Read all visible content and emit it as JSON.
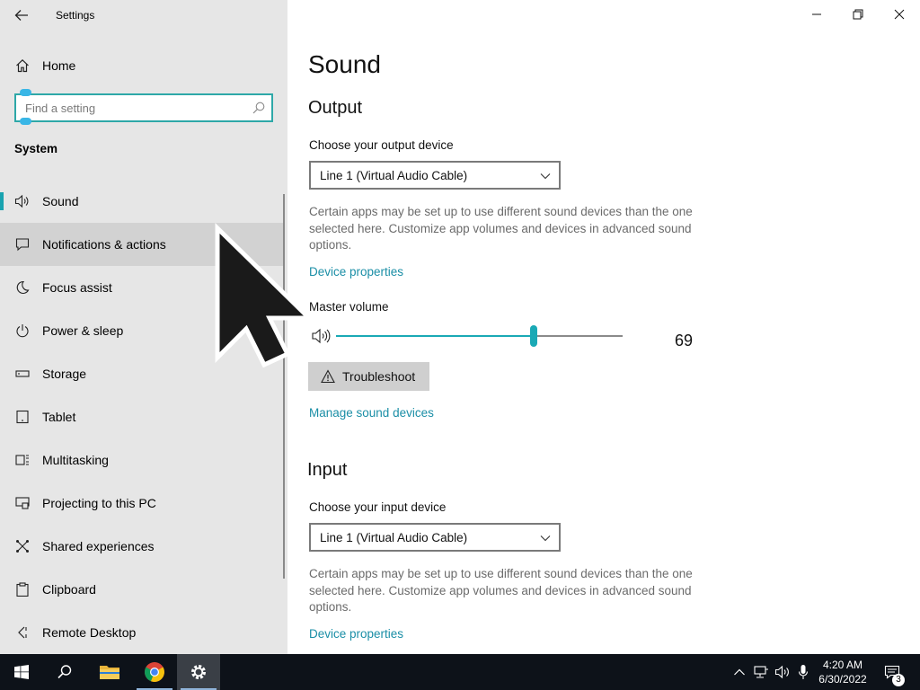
{
  "window": {
    "app_title": "Settings",
    "controls": [
      "minimize",
      "restore",
      "close"
    ]
  },
  "sidebar": {
    "home_label": "Home",
    "search": {
      "placeholder": "Find a setting",
      "value": ""
    },
    "section_label": "System",
    "items": [
      {
        "label": "Sound",
        "icon": "speaker-icon",
        "active": true
      },
      {
        "label": "Notifications & actions",
        "icon": "notification-icon",
        "hover": true
      },
      {
        "label": "Focus assist",
        "icon": "moon-icon"
      },
      {
        "label": "Power & sleep",
        "icon": "power-icon"
      },
      {
        "label": "Storage",
        "icon": "storage-icon"
      },
      {
        "label": "Tablet",
        "icon": "tablet-icon"
      },
      {
        "label": "Multitasking",
        "icon": "multitasking-icon"
      },
      {
        "label": "Projecting to this PC",
        "icon": "projecting-icon"
      },
      {
        "label": "Shared experiences",
        "icon": "shared-experiences-icon"
      },
      {
        "label": "Clipboard",
        "icon": "clipboard-icon"
      },
      {
        "label": "Remote Desktop",
        "icon": "remote-desktop-icon"
      }
    ]
  },
  "main": {
    "title": "Sound",
    "output": {
      "heading": "Output",
      "device_label": "Choose your output device",
      "device_value": "Line 1 (Virtual Audio Cable)",
      "description": "Certain apps may be set up to use different sound devices than the one selected here. Customize app volumes and devices in advanced sound options.",
      "device_properties_link": "Device properties",
      "volume_label": "Master volume",
      "volume_value": "69",
      "volume_level": 69,
      "troubleshoot_label": "Troubleshoot",
      "manage_devices_link": "Manage sound devices"
    },
    "input": {
      "heading": "Input",
      "device_label": "Choose your input device",
      "device_value": "Line 1 (Virtual Audio Cable)",
      "description": "Certain apps may be set up to use different sound devices than the one selected here. Customize app volumes and devices in advanced sound options.",
      "device_properties_link": "Device properties"
    }
  },
  "taskbar": {
    "apps": [
      "start-icon",
      "search-icon",
      "file-explorer-icon",
      "chrome-icon",
      "settings-icon"
    ],
    "time": "4:20 AM",
    "date": "6/30/2022",
    "notification_count": "3"
  },
  "colors": {
    "accent": "#1aa9b5",
    "link": "#1a8ea6",
    "sidebar_bg": "#e6e6e6",
    "taskbar_bg": "#0d1219"
  }
}
